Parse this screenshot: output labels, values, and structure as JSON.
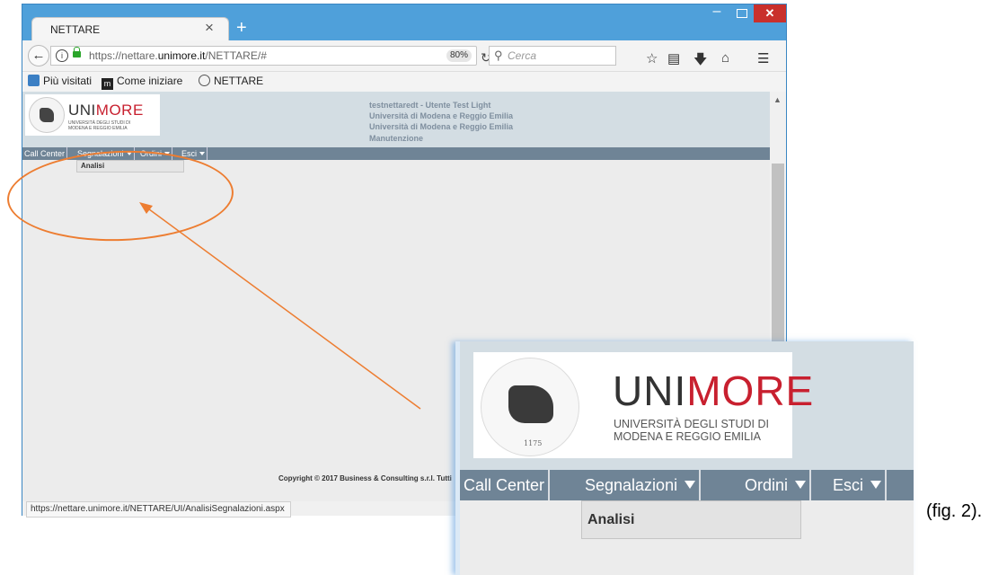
{
  "browser": {
    "tab_title": "NETTARE",
    "tab_close": "×",
    "new_tab": "+",
    "url_prefix": "https://nettare.",
    "url_domain": "unimore.it",
    "url_path": "/NETTARE/#",
    "zoom": "80%",
    "search_placeholder": "Cerca",
    "window_controls": {
      "minimize": "–",
      "close": "✕"
    },
    "bookmarks": [
      {
        "label": "Più visitati",
        "icon": "most-visited-icon"
      },
      {
        "label": "Come iniziare",
        "icon": "getting-started-icon"
      },
      {
        "label": "NETTARE",
        "icon": "globe-icon"
      }
    ],
    "status_url": "https://nettare.unimore.it/NETTARE/UI/AnalisiSegnalazioni.aspx"
  },
  "page": {
    "logo": {
      "uni": "UNI",
      "more": "MORE",
      "subtitle_1": "UNIVERSITÀ DEGLI STUDI DI",
      "subtitle_2": "MODENA E REGGIO EMILIA"
    },
    "user_info": [
      "testnettaredt - Utente Test Light",
      "Università di Modena e Reggio Emilia",
      "Università di Modena e Reggio Emilia",
      "Manutenzione"
    ],
    "menu": [
      {
        "label": "Call Center",
        "dropdown": false
      },
      {
        "label": "Segnalazioni",
        "dropdown": true
      },
      {
        "label": "Ordini",
        "dropdown": true
      },
      {
        "label": "Esci",
        "dropdown": true
      }
    ],
    "dropdown_item": "Analisi",
    "copyright": "Copyright © 2017 Business & Consulting s.r.l. Tutti"
  },
  "inset": {
    "seal_year": "1175"
  },
  "caption": "(fig. 2).",
  "colors": {
    "window_frame": "#4fa0da",
    "header_bg": "#d3dde3",
    "menu_bg": "#6f8496",
    "annotation": "#ed7d31",
    "logo_red": "#c8202f"
  }
}
